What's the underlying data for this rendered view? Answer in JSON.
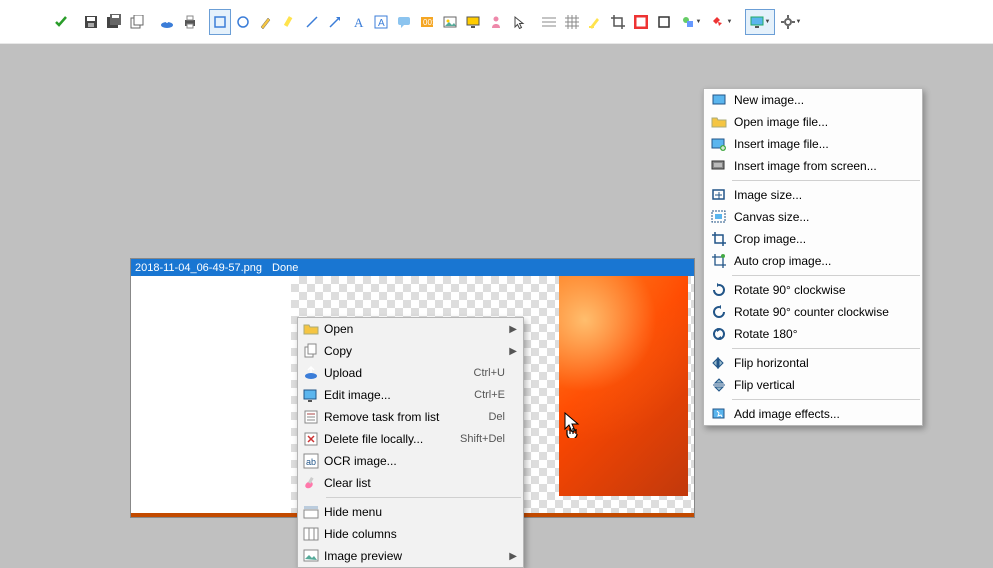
{
  "toolbar": {
    "buttons": [
      "ok-icon",
      "save-icon",
      "save-all-icon",
      "copy-icon",
      "upload-icon",
      "print-icon",
      "rect-select-icon",
      "ellipse-select-icon",
      "pencil-icon",
      "marker-icon",
      "line-icon",
      "arrow-icon",
      "text-icon",
      "text-outline-icon",
      "speech-icon",
      "step-icon",
      "image-icon",
      "monitor-icon",
      "person-icon",
      "pointer-icon",
      "grid1-icon",
      "grid2-icon",
      "highlight-icon",
      "crop-icon",
      "border-red-icon",
      "border-black-icon",
      "shapes-icon",
      "fx-icon",
      "screen-icon",
      "gear-icon"
    ]
  },
  "window": {
    "filename": "2018-11-04_06-49-57.png",
    "status": "Done"
  },
  "context_menu": [
    {
      "icon": "open-icon",
      "label": "Open",
      "submenu": true
    },
    {
      "icon": "copy-icon",
      "label": "Copy",
      "submenu": true
    },
    {
      "icon": "upload-icon",
      "label": "Upload",
      "shortcut": "Ctrl+U"
    },
    {
      "icon": "edit-icon",
      "label": "Edit image...",
      "shortcut": "Ctrl+E"
    },
    {
      "icon": "remove-icon",
      "label": "Remove task from list",
      "shortcut": "Del"
    },
    {
      "icon": "delete-icon",
      "label": "Delete file locally...",
      "shortcut": "Shift+Del"
    },
    {
      "icon": "ocr-icon",
      "label": "OCR image..."
    },
    {
      "icon": "clear-icon",
      "label": "Clear list"
    },
    {
      "sep": true
    },
    {
      "icon": "hidemenu-icon",
      "label": "Hide menu"
    },
    {
      "icon": "hidecol-icon",
      "label": "Hide columns"
    },
    {
      "icon": "preview-icon",
      "label": "Image preview",
      "submenu": true
    }
  ],
  "dropdown_menu": [
    {
      "icon": "newimg-icon",
      "label": "New image..."
    },
    {
      "icon": "openimg-icon",
      "label": "Open image file..."
    },
    {
      "icon": "insertimg-icon",
      "label": "Insert image file..."
    },
    {
      "icon": "insertscreen-icon",
      "label": "Insert image from screen..."
    },
    {
      "sep": true
    },
    {
      "icon": "imgsize-icon",
      "label": "Image size..."
    },
    {
      "icon": "canvassize-icon",
      "label": "Canvas size..."
    },
    {
      "icon": "cropimg-icon",
      "label": "Crop image..."
    },
    {
      "icon": "autocrop-icon",
      "label": "Auto crop image..."
    },
    {
      "sep": true
    },
    {
      "icon": "rot90cw-icon",
      "label": "Rotate 90° clockwise"
    },
    {
      "icon": "rot90ccw-icon",
      "label": "Rotate 90° counter clockwise"
    },
    {
      "icon": "rot180-icon",
      "label": "Rotate 180°"
    },
    {
      "sep": true
    },
    {
      "icon": "fliph-icon",
      "label": "Flip horizontal"
    },
    {
      "icon": "flipv-icon",
      "label": "Flip vertical"
    },
    {
      "sep": true
    },
    {
      "icon": "effects-icon",
      "label": "Add image effects..."
    }
  ]
}
